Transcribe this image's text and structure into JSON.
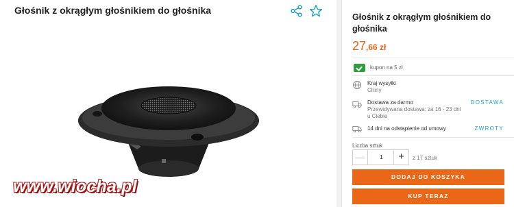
{
  "product": {
    "title": "Głośnik z okrągłym głośnikiem do głośnika"
  },
  "icons": {
    "share": "share-icon",
    "favorite": "star-outline-icon",
    "coupon": "coupon-check-icon",
    "country": "globe-icon",
    "delivery": "truck-icon",
    "returns": "return-truck-icon"
  },
  "watermark": "www.wiocha.pl",
  "buy_box": {
    "title": "Głośnik z okrągłym głośnikiem do głośnika",
    "price_integer": "27",
    "price_decimal": ",66 zł",
    "coupon": "kupon na 5 zł",
    "ship_country_label": "Kraj wysyłki",
    "ship_country_value": "Chiny",
    "delivery_title": "Dostawa za darmo",
    "delivery_estimate_line1": "Przewidywana dostawa: za 16 - 23 dni",
    "delivery_estimate_line2": "u Ciebie",
    "delivery_link": "DOSTAWA",
    "returns_text": "14 dni na odstąpienie od umowy",
    "returns_link": "ZWROTY",
    "quantity_label": "Liczba sztuk",
    "quantity_value": "1",
    "quantity_stock": "z 17 sztuk",
    "add_to_cart": "DODAJ DO KOSZYKA",
    "buy_now": "KUP TERAZ"
  },
  "colors": {
    "accent": "#ea6718",
    "price": "#e0651c",
    "link": "#19a3b8",
    "share_icon": "#1fa3b3",
    "coupon": "#2f9e3a"
  }
}
